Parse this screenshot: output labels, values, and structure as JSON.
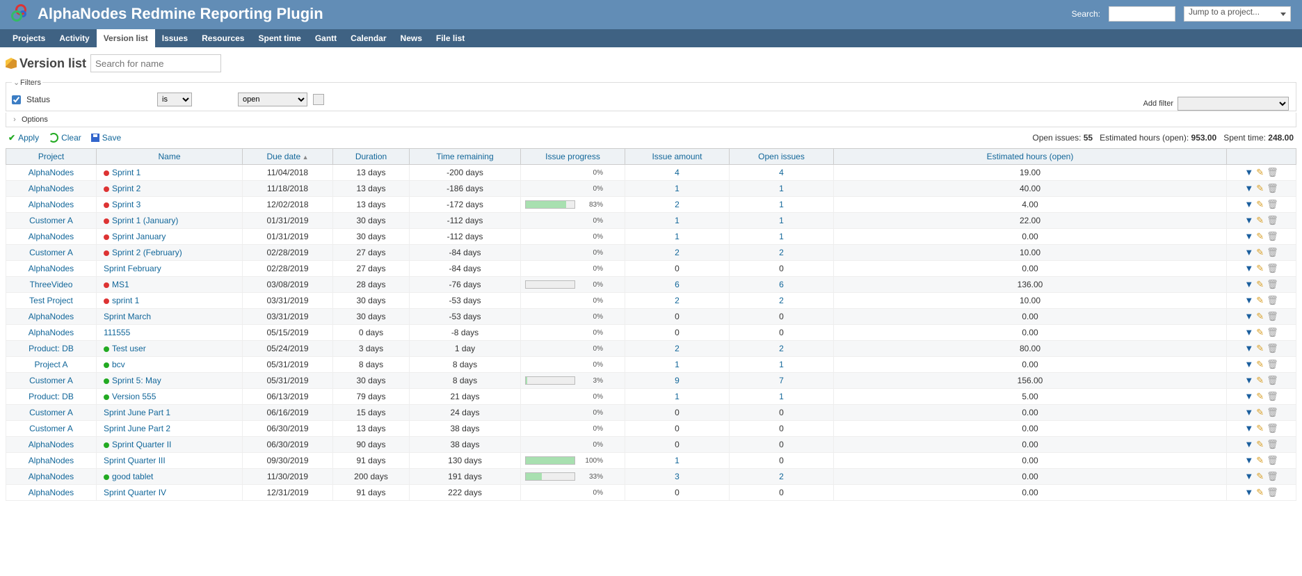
{
  "app": {
    "title": "AlphaNodes Redmine Reporting Plugin"
  },
  "header": {
    "search_label": "Search:",
    "project_jump": "Jump to a project..."
  },
  "nav": {
    "items": [
      "Projects",
      "Activity",
      "Version list",
      "Issues",
      "Resources",
      "Spent time",
      "Gantt",
      "Calendar",
      "News",
      "File list"
    ],
    "active_index": 2
  },
  "page": {
    "title": "Version list",
    "search_placeholder": "Search for name"
  },
  "filters": {
    "legend": "Filters",
    "status_label": "Status",
    "operator": "is",
    "value": "open",
    "add_filter_label": "Add filter"
  },
  "options": {
    "legend": "Options"
  },
  "actions": {
    "apply": "Apply",
    "clear": "Clear",
    "save": "Save"
  },
  "stats": {
    "open_issues_label": "Open issues:",
    "open_issues": "55",
    "est_hours_label": "Estimated hours (open):",
    "est_hours": "953.00",
    "spent_time_label": "Spent time:",
    "spent_time": "248.00"
  },
  "columns": {
    "project": "Project",
    "name": "Name",
    "due": "Due date",
    "duration": "Duration",
    "remaining": "Time remaining",
    "progress": "Issue progress",
    "amount": "Issue amount",
    "open": "Open issues",
    "est": "Estimated hours (open)"
  },
  "rows": [
    {
      "project": "AlphaNodes",
      "dot": "red",
      "name": "Sprint 1",
      "due": "11/04/2018",
      "duration": "13 days",
      "remaining": "-200 days",
      "progress": 0,
      "amount": "4",
      "amount_link": true,
      "open": "4",
      "open_link": true,
      "est": "19.00"
    },
    {
      "project": "AlphaNodes",
      "dot": "red",
      "name": "Sprint 2",
      "due": "11/18/2018",
      "duration": "13 days",
      "remaining": "-186 days",
      "progress": 0,
      "amount": "1",
      "amount_link": true,
      "open": "1",
      "open_link": true,
      "est": "40.00"
    },
    {
      "project": "AlphaNodes",
      "dot": "red",
      "name": "Sprint 3",
      "due": "12/02/2018",
      "duration": "13 days",
      "remaining": "-172 days",
      "progress": 83,
      "amount": "2",
      "amount_link": true,
      "open": "1",
      "open_link": true,
      "est": "4.00"
    },
    {
      "project": "Customer A",
      "dot": "red",
      "name": "Sprint 1 (January)",
      "due": "01/31/2019",
      "duration": "30 days",
      "remaining": "-112 days",
      "progress": 0,
      "amount": "1",
      "amount_link": true,
      "open": "1",
      "open_link": true,
      "est": "22.00"
    },
    {
      "project": "AlphaNodes",
      "dot": "red",
      "name": "Sprint January",
      "due": "01/31/2019",
      "duration": "30 days",
      "remaining": "-112 days",
      "progress": 0,
      "amount": "1",
      "amount_link": true,
      "open": "1",
      "open_link": true,
      "est": "0.00"
    },
    {
      "project": "Customer A",
      "dot": "red",
      "name": "Sprint 2 (February)",
      "due": "02/28/2019",
      "duration": "27 days",
      "remaining": "-84 days",
      "progress": 0,
      "amount": "2",
      "amount_link": true,
      "open": "2",
      "open_link": true,
      "est": "10.00"
    },
    {
      "project": "AlphaNodes",
      "dot": "",
      "name": "Sprint February",
      "due": "02/28/2019",
      "duration": "27 days",
      "remaining": "-84 days",
      "progress": 0,
      "amount": "0",
      "amount_link": false,
      "open": "0",
      "open_link": false,
      "est": "0.00"
    },
    {
      "project": "ThreeVideo",
      "dot": "red",
      "name": "MS1",
      "due": "03/08/2019",
      "duration": "28 days",
      "remaining": "-76 days",
      "progress": 0,
      "show_bar": true,
      "amount": "6",
      "amount_link": true,
      "open": "6",
      "open_link": true,
      "est": "136.00"
    },
    {
      "project": "Test Project",
      "dot": "red",
      "name": "sprint 1",
      "due": "03/31/2019",
      "duration": "30 days",
      "remaining": "-53 days",
      "progress": 0,
      "amount": "2",
      "amount_link": true,
      "open": "2",
      "open_link": true,
      "est": "10.00"
    },
    {
      "project": "AlphaNodes",
      "dot": "",
      "name": "Sprint March",
      "due": "03/31/2019",
      "duration": "30 days",
      "remaining": "-53 days",
      "progress": 0,
      "amount": "0",
      "amount_link": false,
      "open": "0",
      "open_link": false,
      "est": "0.00"
    },
    {
      "project": "AlphaNodes",
      "dot": "",
      "name": "111555",
      "due": "05/15/2019",
      "duration": "0 days",
      "remaining": "-8 days",
      "progress": 0,
      "amount": "0",
      "amount_link": false,
      "open": "0",
      "open_link": false,
      "est": "0.00"
    },
    {
      "project": "Product: DB",
      "dot": "green",
      "name": "Test user",
      "due": "05/24/2019",
      "duration": "3 days",
      "remaining": "1 day",
      "progress": 0,
      "amount": "2",
      "amount_link": true,
      "open": "2",
      "open_link": true,
      "est": "80.00"
    },
    {
      "project": "Project A",
      "dot": "green",
      "name": "bcv",
      "due": "05/31/2019",
      "duration": "8 days",
      "remaining": "8 days",
      "progress": 0,
      "amount": "1",
      "amount_link": true,
      "open": "1",
      "open_link": true,
      "est": "0.00"
    },
    {
      "project": "Customer A",
      "dot": "green",
      "name": "Sprint 5: May",
      "due": "05/31/2019",
      "duration": "30 days",
      "remaining": "8 days",
      "progress": 3,
      "show_bar": true,
      "amount": "9",
      "amount_link": true,
      "open": "7",
      "open_link": true,
      "est": "156.00"
    },
    {
      "project": "Product: DB",
      "dot": "green",
      "name": "Version 555",
      "due": "06/13/2019",
      "duration": "79 days",
      "remaining": "21 days",
      "progress": 0,
      "amount": "1",
      "amount_link": true,
      "open": "1",
      "open_link": true,
      "est": "5.00"
    },
    {
      "project": "Customer A",
      "dot": "",
      "name": "Sprint June Part 1",
      "due": "06/16/2019",
      "duration": "15 days",
      "remaining": "24 days",
      "progress": 0,
      "amount": "0",
      "amount_link": false,
      "open": "0",
      "open_link": false,
      "est": "0.00"
    },
    {
      "project": "Customer A",
      "dot": "",
      "name": "Sprint June Part 2",
      "due": "06/30/2019",
      "duration": "13 days",
      "remaining": "38 days",
      "progress": 0,
      "amount": "0",
      "amount_link": false,
      "open": "0",
      "open_link": false,
      "est": "0.00"
    },
    {
      "project": "AlphaNodes",
      "dot": "green",
      "name": "Sprint Quarter II",
      "due": "06/30/2019",
      "duration": "90 days",
      "remaining": "38 days",
      "progress": 0,
      "amount": "0",
      "amount_link": false,
      "open": "0",
      "open_link": false,
      "est": "0.00"
    },
    {
      "project": "AlphaNodes",
      "dot": "",
      "name": "Sprint Quarter III",
      "due": "09/30/2019",
      "duration": "91 days",
      "remaining": "130 days",
      "progress": 100,
      "amount": "1",
      "amount_link": true,
      "open": "0",
      "open_link": false,
      "est": "0.00"
    },
    {
      "project": "AlphaNodes",
      "dot": "green",
      "name": "good tablet",
      "due": "11/30/2019",
      "duration": "200 days",
      "remaining": "191 days",
      "progress": 33,
      "show_bar": true,
      "amount": "3",
      "amount_link": true,
      "open": "2",
      "open_link": true,
      "est": "0.00"
    },
    {
      "project": "AlphaNodes",
      "dot": "",
      "name": "Sprint Quarter IV",
      "due": "12/31/2019",
      "duration": "91 days",
      "remaining": "222 days",
      "progress": 0,
      "amount": "0",
      "amount_link": false,
      "open": "0",
      "open_link": false,
      "est": "0.00"
    }
  ]
}
